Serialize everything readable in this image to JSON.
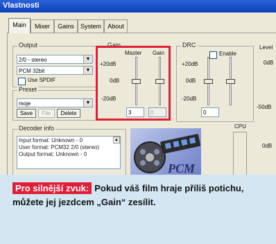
{
  "window": {
    "title": "Vlastnosti"
  },
  "tabs": [
    {
      "label": "Main",
      "active": true
    },
    {
      "label": "Mixer"
    },
    {
      "label": "Gains"
    },
    {
      "label": "System"
    },
    {
      "label": "About"
    }
  ],
  "output": {
    "group_label": "Output",
    "channels_value": "2/0 - stereo",
    "format_value": "PCM 32bit",
    "spdif_label": "Use SPDIF",
    "spdif_checked": false
  },
  "preset": {
    "group_label": "Preset",
    "value": "moje",
    "save_label": "Save",
    "file_label": "File",
    "delete_label": "Delete"
  },
  "gain": {
    "group_label": "Gain",
    "master_label": "Master",
    "gain_label": "Gain",
    "scale_top": "+20dB",
    "scale_mid": "0dB",
    "scale_bottom": "-20dB",
    "master_value": "3",
    "gain_value": "0"
  },
  "drc": {
    "group_label": "DRC",
    "enable_label": "Enable",
    "enable_checked": false,
    "scale_top": "+20dB",
    "scale_mid": "0dB",
    "scale_bottom": "-20dB",
    "value": "0"
  },
  "levels": {
    "group_label": "Level",
    "label_top": "0dB",
    "label_mid": "-50dB",
    "label_bottom": "0dB"
  },
  "decoder": {
    "group_label": "Decoder info",
    "lines": [
      "Input format: Unknown - 0",
      "User format: PCM32 2/0 (stereo)",
      "Output format: Unknown - 0"
    ]
  },
  "cpu": {
    "label": "CPU"
  },
  "logo": {
    "text": "PCM"
  },
  "caption": {
    "badge": "Pro silnější zvuk:",
    "text": "Pokud váš film hraje příliš potichu, můžete jej jezdcem „Gain“ zesílit."
  },
  "colors": {
    "accent": "#e01e37",
    "titlebar": "#0a3fb8",
    "background": "#d4e6f2",
    "window": "#ece9d8"
  }
}
